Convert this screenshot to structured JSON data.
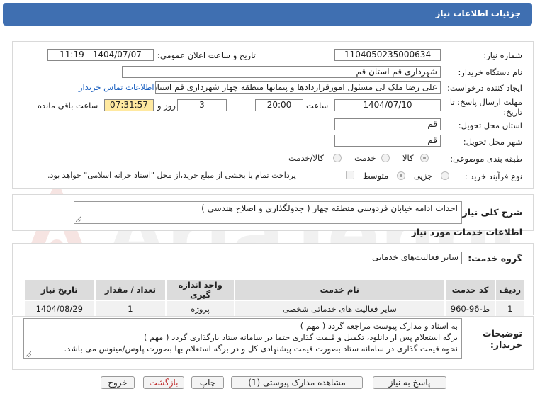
{
  "header": {
    "title": "جزئیات اطلاعات نیاز"
  },
  "fields": {
    "need_number_label": "شماره نیاز:",
    "need_number": "1104050235000634",
    "announce_label": "تاریخ و ساعت اعلان عمومی:",
    "announce_value": "1404/07/07 - 11:19",
    "buyer_org_label": "نام دستگاه خریدار:",
    "buyer_org": "شهرداری قم استان قم",
    "creator_label": "ایجاد کننده درخواست:",
    "creator": "علی رضا ملک لی مسئول امورقراردادها و پیمانها منطقه چهار  شهرداری قم استان قم",
    "contact_link": "اطلاعات تماس خریدار",
    "deadline_label_1": "مهلت ارسال پاسخ: تا",
    "deadline_label_2": "تاریخ:",
    "deadline_date": "1404/07/10",
    "time_label": "ساعت",
    "deadline_time": "20:00",
    "days_value": "3",
    "days_label": "روز و",
    "remaining_time": "07:31:57",
    "remaining_label": "ساعت باقی مانده",
    "province_label": "استان محل تحویل:",
    "province": "قم",
    "city_label": "شهر محل تحویل:",
    "city": "قم",
    "category_label": "طبقه بندی موضوعی:",
    "category_options": [
      "کالا",
      "خدمت",
      "کالا/خدمت"
    ],
    "process_label": "نوع فرآیند خرید :",
    "process_options": [
      "جزیی",
      "متوسط"
    ],
    "payment_note": "پرداخت تمام یا بخشی از مبلغ خرید،از محل \"اسناد خزانه اسلامی\" خواهد بود."
  },
  "description": {
    "label": "شرح کلی نیاز:",
    "value": "احداث ادامه خیابان فردوسی منطقه چهار ( جدولگذاری و اصلاح هندسی )"
  },
  "services": {
    "section_title": "اطلاعات خدمات مورد نیاز",
    "group_label": "گروه خدمت:",
    "group_value": "سایر فعالیت‌های خدماتی",
    "table": {
      "headers": [
        "ردیف",
        "کد خدمت",
        "نام خدمت",
        "واحد اندازه گیری",
        "تعداد / مقدار",
        "تاریخ نیاز"
      ],
      "rows": [
        [
          "1",
          "ط-96-960",
          "سایر فعالیت های خدماتی شخصی",
          "پروژه",
          "1",
          "1404/08/29"
        ]
      ]
    }
  },
  "buyer_notes": {
    "label_1": "توضیحات",
    "label_2": "خریدار:",
    "lines": [
      "به اسناد و مدارک پیوست مراجعه گردد ( مهم )",
      "برگه استعلام پس از دانلود، تکمیل و قیمت گذاری حتما در سامانه ستاد بارگذاری گردد ( مهم )",
      "نحوه قیمت گذاری در سامانه ستاد بصورت قیمت پیشنهادی کل و در برگه استعلام بها بصورت پلوس/مینوس می باشد."
    ]
  },
  "buttons": {
    "reply": "پاسخ به نیاز",
    "attachments": "مشاهده مدارک پیوستی (1)",
    "print": "چاپ",
    "back": "بازگشت",
    "exit": "خروج"
  },
  "watermark": {
    "text": "AriaTender.net"
  },
  "colors": {
    "header_bg": "#3f6fb1",
    "highlight": "#ffe9a0",
    "link": "#1a5fbf",
    "back_text": "#c03030"
  }
}
